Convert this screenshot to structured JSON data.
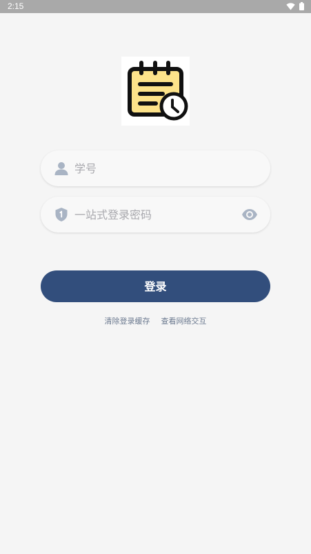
{
  "status_bar": {
    "time": "2:15",
    "wifi_icon": "wifi-icon",
    "battery_icon": "battery-icon"
  },
  "app": {
    "logo_icon": "notepad-clock-icon"
  },
  "login_form": {
    "username": {
      "icon": "user-icon",
      "placeholder": "学号",
      "value": ""
    },
    "password": {
      "icon": "shield-icon",
      "placeholder": "一站式登录密码",
      "value": "",
      "toggle_icon": "eye-icon"
    },
    "submit_label": "登录"
  },
  "links": {
    "clear_cache": "清除登录缓存",
    "view_network": "查看网络交互"
  },
  "colors": {
    "accent": "#324e7c",
    "background": "#f5f5f5",
    "link": "#6c7a90",
    "icon": "#a9b4c4",
    "logo_fill": "#fde38a"
  }
}
